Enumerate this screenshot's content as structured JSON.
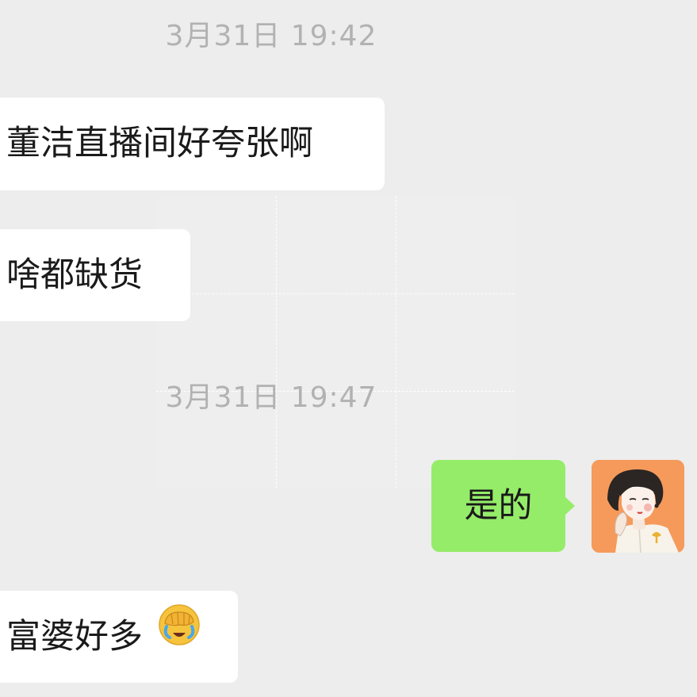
{
  "chat": {
    "timestamp_1": "3月31日 19:42",
    "timestamp_2": "3月31日 19:47",
    "messages": [
      {
        "text": "董洁直播间好夸张啊"
      },
      {
        "text": "啥都缺货"
      },
      {
        "text": "是的"
      },
      {
        "text": "富婆好多",
        "emoji": "facepalm-crying-emoji"
      }
    ]
  },
  "colors": {
    "background": "#ededed",
    "incoming_bubble": "#ffffff",
    "outgoing_bubble": "#95ec69",
    "timestamp_text": "#b2b2b2",
    "avatar_background": "#f59a5b"
  }
}
